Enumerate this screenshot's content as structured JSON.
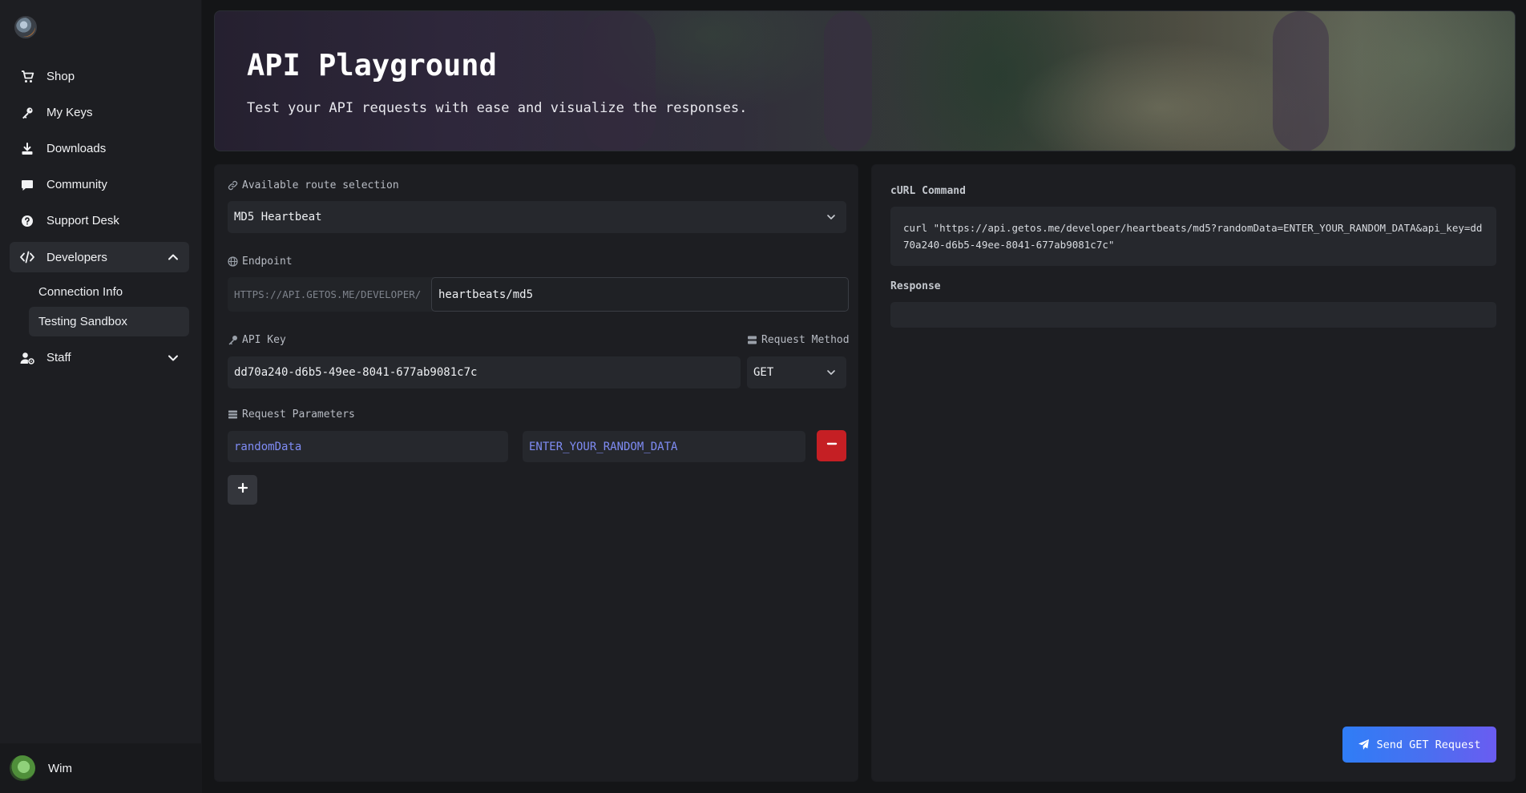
{
  "sidebar": {
    "items": [
      {
        "label": "Shop",
        "icon": "cart-icon"
      },
      {
        "label": "My Keys",
        "icon": "key-icon"
      },
      {
        "label": "Downloads",
        "icon": "download-icon"
      },
      {
        "label": "Community",
        "icon": "chat-icon"
      },
      {
        "label": "Support Desk",
        "icon": "question-icon"
      },
      {
        "label": "Developers",
        "icon": "code-icon",
        "expanded": true
      },
      {
        "label": "Staff",
        "icon": "user-gear-icon",
        "expanded": false
      }
    ],
    "developers_sub": [
      {
        "label": "Connection Info"
      },
      {
        "label": "Testing Sandbox",
        "active": true
      }
    ],
    "user": {
      "name": "Wim"
    }
  },
  "hero": {
    "title": "API Playground",
    "subtitle": "Test your API requests with ease and visualize the responses."
  },
  "form": {
    "route_label": "Available route selection",
    "route_value": "MD5 Heartbeat",
    "endpoint_label": "Endpoint",
    "endpoint_prefix": "HTTPS://API.GETOS.ME/DEVELOPER/",
    "endpoint_value": "heartbeats/md5",
    "api_key_label": "API Key",
    "api_key_value": "dd70a240-d6b5-49ee-8041-677ab9081c7c",
    "method_label": "Request Method",
    "method_value": "GET",
    "params_label": "Request Parameters",
    "params": [
      {
        "key": "randomData",
        "value": "ENTER_YOUR_RANDOM_DATA"
      }
    ]
  },
  "output": {
    "curl_label": "cURL Command",
    "curl_command": "curl \"https://api.getos.me/developer/heartbeats/md5?randomData=ENTER_YOUR_RANDOM_DATA&api_key=dd70a240-d6b5-49ee-8041-677ab9081c7c\"",
    "response_label": "Response",
    "send_label": "Send GET Request"
  },
  "colors": {
    "accent": "#3b82f6",
    "danger": "#c51f24",
    "param_text": "#7f8cf4"
  }
}
